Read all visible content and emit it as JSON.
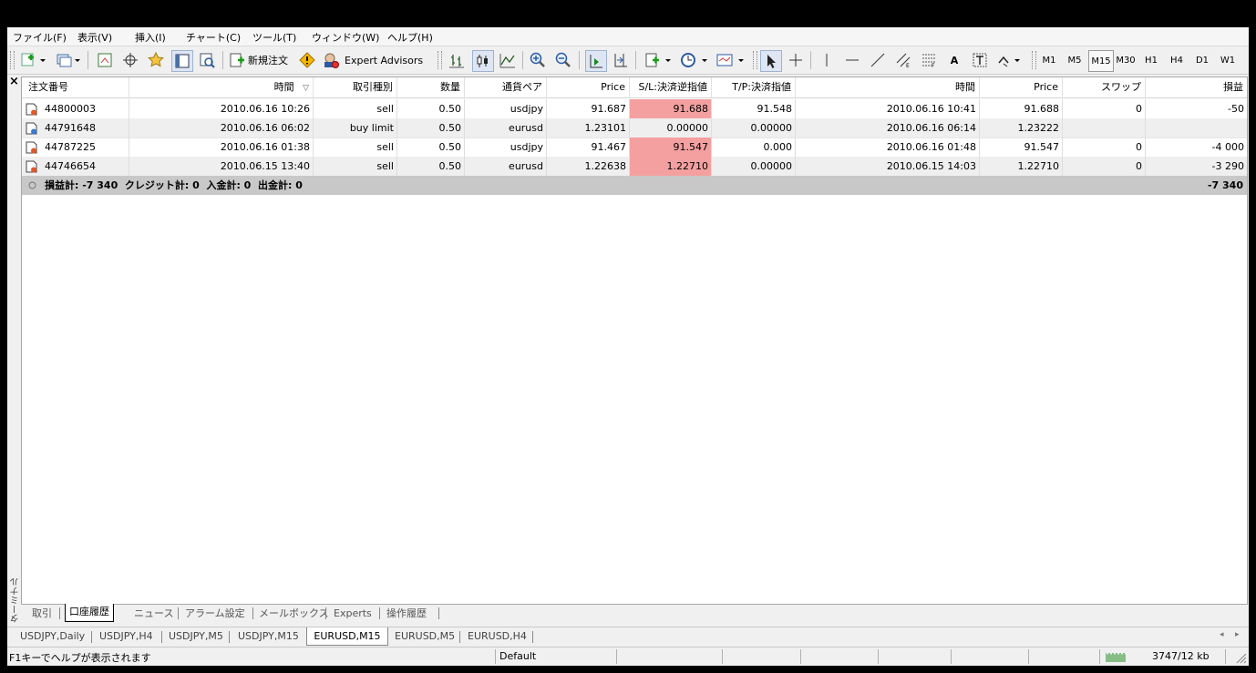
{
  "menu": [
    "ファイル(F)",
    "表示(V)",
    "挿入(I)",
    "チャート(C)",
    "ツール(T)",
    "ウィンドウ(W)",
    "ヘルプ(H)"
  ],
  "toolbar": {
    "new_order_label": "新規注文",
    "expert_advisors_label": "Expert Advisors",
    "timeframes": [
      "M1",
      "M5",
      "M15",
      "M30",
      "H1",
      "H4",
      "D1",
      "W1"
    ],
    "selected_timeframe": "M15",
    "text_tool_label": "A"
  },
  "terminal": {
    "vertical_label": "ターミナル",
    "columns": [
      "注文番号",
      "時間",
      "取引種別",
      "数量",
      "通貨ペア",
      "Price",
      "S/L:決済逆指値",
      "T/P:決済指値",
      "時間",
      "Price",
      "スワップ",
      "損益"
    ],
    "sort_indicator": "▽",
    "rows": [
      {
        "order": "44800003",
        "open_time": "2010.06.16 10:26",
        "type": "sell",
        "size": "0.50",
        "symbol": "usdjpy",
        "open_price": "91.687",
        "sl": "91.688",
        "tp": "91.548",
        "close_time": "2010.06.16 10:41",
        "close_price": "91.688",
        "swap": "0",
        "profit": "-50",
        "sl_highlight": true
      },
      {
        "order": "44791648",
        "open_time": "2010.06.16 06:02",
        "type": "buy limit",
        "size": "0.50",
        "symbol": "eurusd",
        "open_price": "1.23101",
        "sl": "0.00000",
        "tp": "0.00000",
        "close_time": "2010.06.16 06:14",
        "close_price": "1.23222",
        "swap": "",
        "profit": "",
        "sl_highlight": false
      },
      {
        "order": "44787225",
        "open_time": "2010.06.16 01:38",
        "type": "sell",
        "size": "0.50",
        "symbol": "usdjpy",
        "open_price": "91.467",
        "sl": "91.547",
        "tp": "0.000",
        "close_time": "2010.06.16 01:48",
        "close_price": "91.547",
        "swap": "0",
        "profit": "-4 000",
        "sl_highlight": true
      },
      {
        "order": "44746654",
        "open_time": "2010.06.15 13:40",
        "type": "sell",
        "size": "0.50",
        "symbol": "eurusd",
        "open_price": "1.22638",
        "sl": "1.22710",
        "tp": "0.00000",
        "close_time": "2010.06.15 14:03",
        "close_price": "1.22710",
        "swap": "0",
        "profit": "-3 290",
        "sl_highlight": true
      }
    ],
    "summary": "損益計: -7 340  クレジット計: 0  入金計: 0  出金計: 0",
    "summary_total": "-7 340",
    "tabs": [
      "取引",
      "口座履歴",
      "ニュース",
      "アラーム設定",
      "メールボックス",
      "Experts",
      "操作履歴"
    ],
    "active_tab": "口座履歴"
  },
  "chart_tabs": [
    "USDJPY,Daily",
    "USDJPY,H4",
    "USDJPY,M5",
    "USDJPY,M15",
    "EURUSD,M15",
    "EURUSD,M5",
    "EURUSD,H4"
  ],
  "active_chart_tab": "EURUSD,M15",
  "status": {
    "help_text": "F1キーでヘルプが表示されます",
    "profile": "Default",
    "traffic": "3747/12 kb"
  },
  "colors": {
    "sl_highlight": "#f4a0a0",
    "summary_bg": "#c8c8c8",
    "alt_row": "#efefef"
  }
}
